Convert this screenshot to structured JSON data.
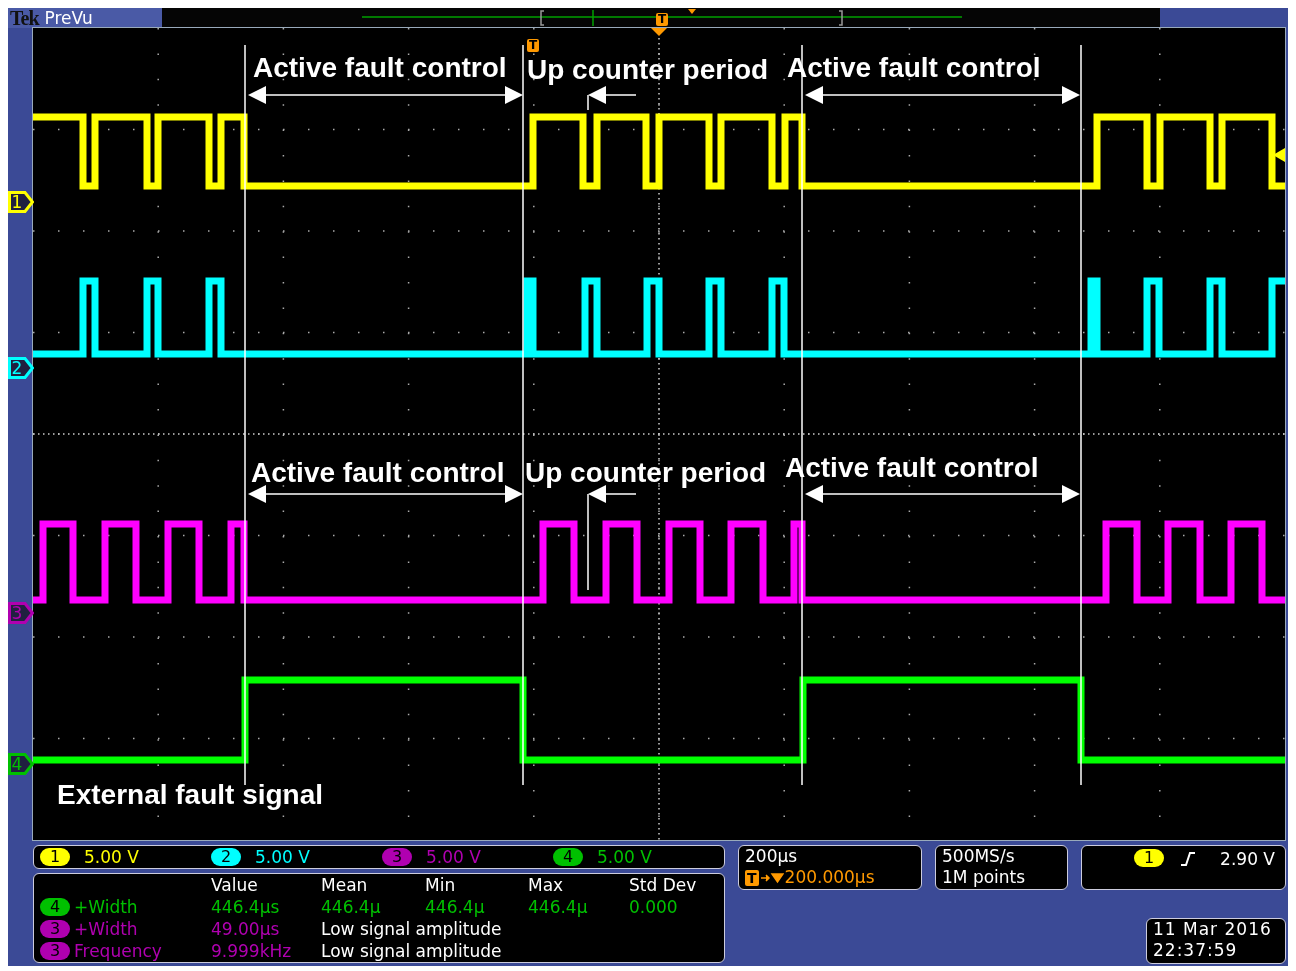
{
  "header": {
    "brand": "Tek",
    "mode": "PreVu",
    "trigger_badge": "T"
  },
  "plot": {
    "trigger_badge": "T",
    "annotations": [
      {
        "text": "Active fault control"
      },
      {
        "text": "Up counter period"
      },
      {
        "text": "Active fault control"
      },
      {
        "text": "Active fault control"
      },
      {
        "text": "Up counter period"
      },
      {
        "text": "Active fault control"
      },
      {
        "text": "External fault signal"
      }
    ]
  },
  "channel_markers": [
    {
      "label": "1",
      "color": "#ffff00"
    },
    {
      "label": "2",
      "color": "#00ffff"
    },
    {
      "label": "3",
      "color": "#b000b0"
    },
    {
      "label": "4",
      "color": "#00c000"
    }
  ],
  "channel_scales": [
    {
      "channel": "1",
      "value": "5.00 V",
      "color": "#ffff00"
    },
    {
      "channel": "2",
      "value": "5.00 V",
      "color": "#00ffff"
    },
    {
      "channel": "3",
      "value": "5.00 V",
      "color": "#b000b0"
    },
    {
      "channel": "4",
      "value": "5.00 V",
      "color": "#00c000"
    }
  ],
  "measurements": {
    "columns": [
      "Value",
      "Mean",
      "Min",
      "Max",
      "Std Dev"
    ],
    "rows": [
      {
        "kind": "stats",
        "channel": "4",
        "color": "#00c000",
        "name": "+Width",
        "cells": [
          "446.4µs",
          "446.4µ",
          "446.4µ",
          "446.4µ",
          "0.000"
        ]
      },
      {
        "kind": "note",
        "channel": "3",
        "color": "#b000b0",
        "name": "+Width",
        "cells": [
          "49.00µs"
        ],
        "note": "Low signal amplitude"
      },
      {
        "kind": "note",
        "channel": "3",
        "color": "#b000b0",
        "name": "Frequency",
        "cells": [
          "9.999kHz"
        ],
        "note": "Low signal amplitude"
      }
    ]
  },
  "timebase": {
    "scale": "200µs",
    "trigger_badge": "T",
    "delay": "200.000µs"
  },
  "acquisition": {
    "rate": "500MS/s",
    "length": "1M points"
  },
  "trigger": {
    "channel": "1",
    "color": "#ffff00",
    "level": "2.90 V"
  },
  "datetime": {
    "date": "11 Mar  2016",
    "time": "22:37:59"
  }
}
